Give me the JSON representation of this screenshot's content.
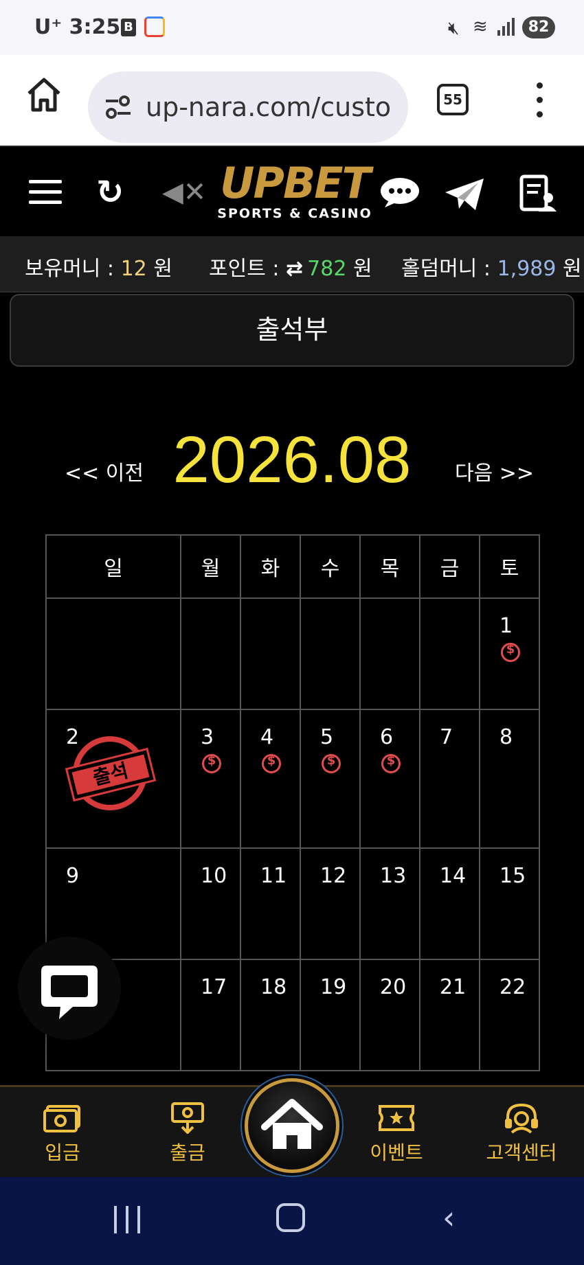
{
  "status_bar": {
    "carrier": "U⁺",
    "time": "3:25",
    "b_icon": "B",
    "battery": "82"
  },
  "browser": {
    "url": "up-nara.com/custo",
    "tab_count": "55"
  },
  "header": {
    "brand": "UPBET",
    "tagline": "SPORTS & CASINO"
  },
  "balances": {
    "money_label": "보유머니 :",
    "money_value": "12",
    "points_label": "포인트 :",
    "points_value": "782",
    "holdem_label": "홀덤머니 :",
    "holdem_value": "1,989",
    "unit": "원"
  },
  "page_title": "출석부",
  "calendar": {
    "prev_label": "<< 이전",
    "next_label": "다음 >>",
    "month": "2026.08",
    "weekdays": [
      "일",
      "월",
      "화",
      "수",
      "목",
      "금",
      "토"
    ],
    "stamp_text": "출석",
    "weeks": [
      [
        "",
        "",
        "",
        "",
        "",
        "",
        "1"
      ],
      [
        "2",
        "3",
        "4",
        "5",
        "6",
        "7",
        "8"
      ],
      [
        "9",
        "10",
        "11",
        "12",
        "13",
        "14",
        "15"
      ],
      [
        "",
        "17",
        "18",
        "19",
        "20",
        "21",
        "22"
      ]
    ]
  },
  "bottom_nav": {
    "deposit": "입금",
    "withdraw": "출금",
    "event": "이벤트",
    "support": "고객센터"
  },
  "colors": {
    "accent_gold": "#c99a3d",
    "month_yellow": "#f5e23a",
    "points_green": "#58d86a",
    "holdem_blue": "#9cb7e6",
    "stamp_red": "#d63a3a",
    "nav_label": "#f0c040"
  }
}
